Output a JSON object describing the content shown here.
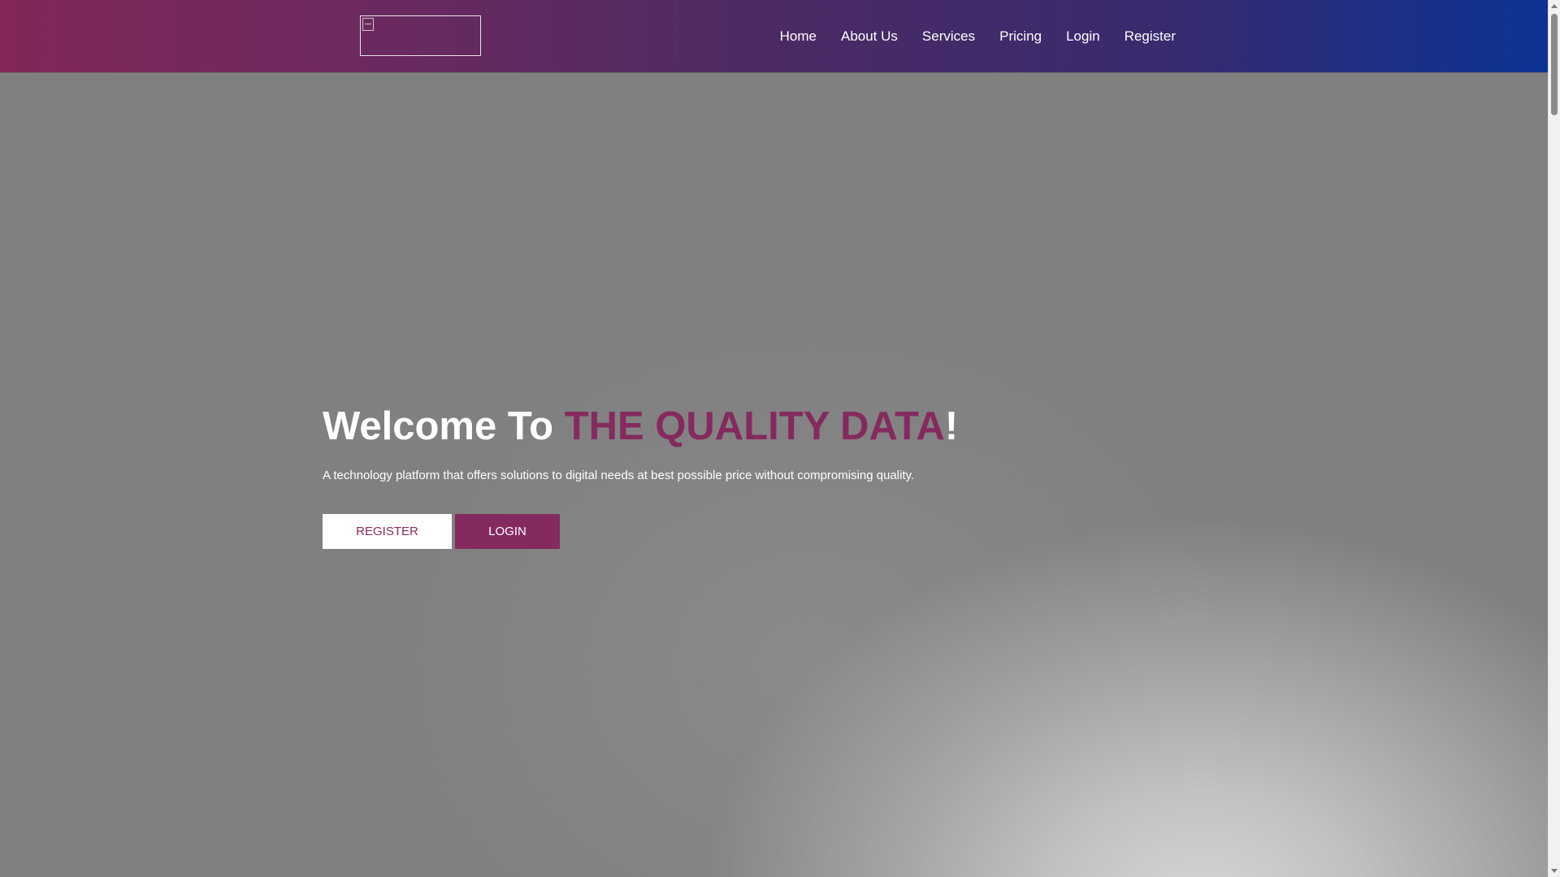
{
  "nav": {
    "items": [
      {
        "label": "Home"
      },
      {
        "label": "About Us"
      },
      {
        "label": "Services"
      },
      {
        "label": "Pricing"
      },
      {
        "label": "Login"
      },
      {
        "label": "Register"
      }
    ]
  },
  "hero": {
    "title_prefix": "Welcome To ",
    "title_brand": "THE QUALITY DATA",
    "title_suffix": "!",
    "subtitle": "A technology platform that offers solutions to digital needs at best possible price without compromising quality.",
    "register_label": "REGISTER",
    "login_label": "LOGIN"
  },
  "colors": {
    "brand": "#852a5e",
    "nav_gradient_start": "#822758",
    "nav_gradient_end": "#0b3394",
    "hero_background": "#808080"
  },
  "icons": {
    "logo": "broken-image-icon"
  }
}
